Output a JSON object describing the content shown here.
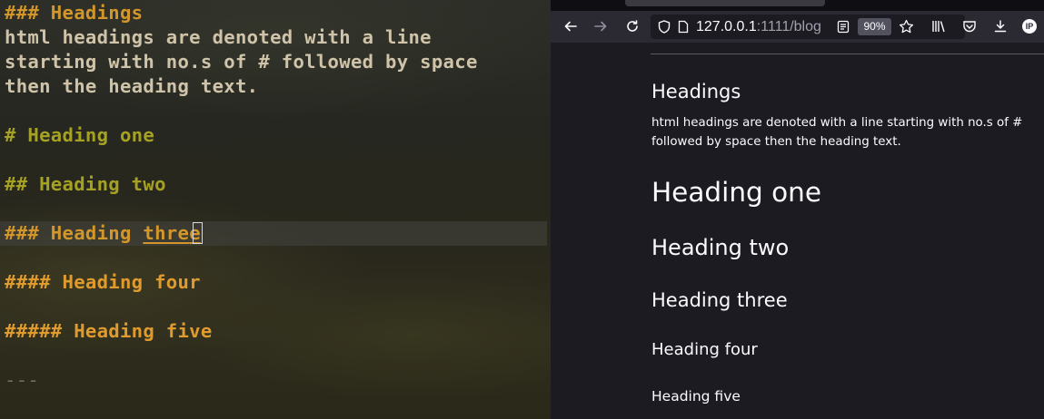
{
  "editor": {
    "lines": [
      {
        "text": "### Headings"
      },
      {
        "text": "html headings are denoted with a line"
      },
      {
        "text": "starting with no.s of # followed by space"
      },
      {
        "text": "then the heading text."
      },
      {
        "text": "# Heading one"
      },
      {
        "text": "## Heading two"
      },
      {
        "prefix": "### Heading ",
        "underlined": "thre",
        "under_cursor": "e"
      },
      {
        "text": "#### Heading four"
      },
      {
        "text": "##### Heading five"
      },
      {
        "text": "---"
      }
    ]
  },
  "browser": {
    "toolbar": {
      "back_icon": "arrow-left-icon",
      "forward_icon": "arrow-right-icon",
      "reload_icon": "reload-icon",
      "url_host": "127.0.0.1",
      "url_rest": ":1111/blog",
      "zoom_level": "90%",
      "avatar_initials": "IP"
    },
    "page": {
      "section_title": "Headings",
      "paragraph": "html headings are denoted with a line starting with no.s of # followed by space then the heading text.",
      "h1": "Heading one",
      "h2": "Heading two",
      "h3": "Heading three",
      "h4": "Heading four",
      "h5": "Heading five"
    }
  }
}
